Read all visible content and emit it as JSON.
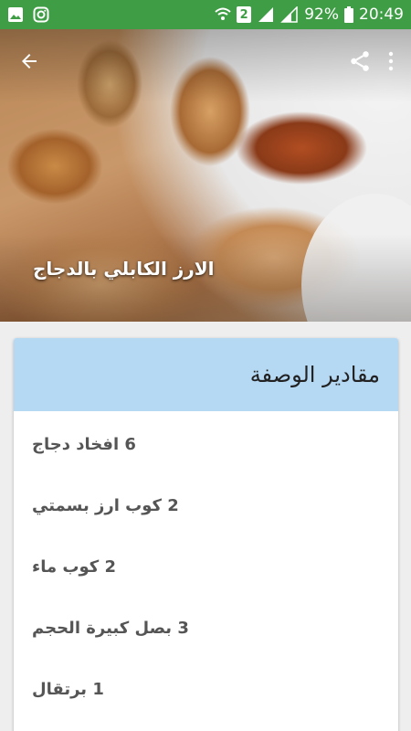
{
  "status_bar": {
    "battery": "92%",
    "time": "20:49",
    "sim_slot": "2",
    "icons": [
      "image-icon",
      "instagram-icon",
      "wifi-icon",
      "signal-icon",
      "battery-icon"
    ]
  },
  "toolbar": {
    "back_icon": "arrow-back-icon",
    "share_icon": "share-icon",
    "more_icon": "more-vert-icon"
  },
  "recipe": {
    "title": "الارز الكابلي بالدجاج"
  },
  "ingredients_card": {
    "header": "مقادير الوصفة",
    "header_color": "#b5d8f3",
    "items": [
      {
        "text": "6 افخاد دجاج"
      },
      {
        "text": "2 كوب ارز بسمتي"
      },
      {
        "text": "2 كوب ماء"
      },
      {
        "text": "3 بصل كبيرة الحجم"
      },
      {
        "text": "1 برتقال"
      }
    ]
  },
  "colors": {
    "status_bar": "#3f9e45",
    "background": "#eeeeee"
  }
}
